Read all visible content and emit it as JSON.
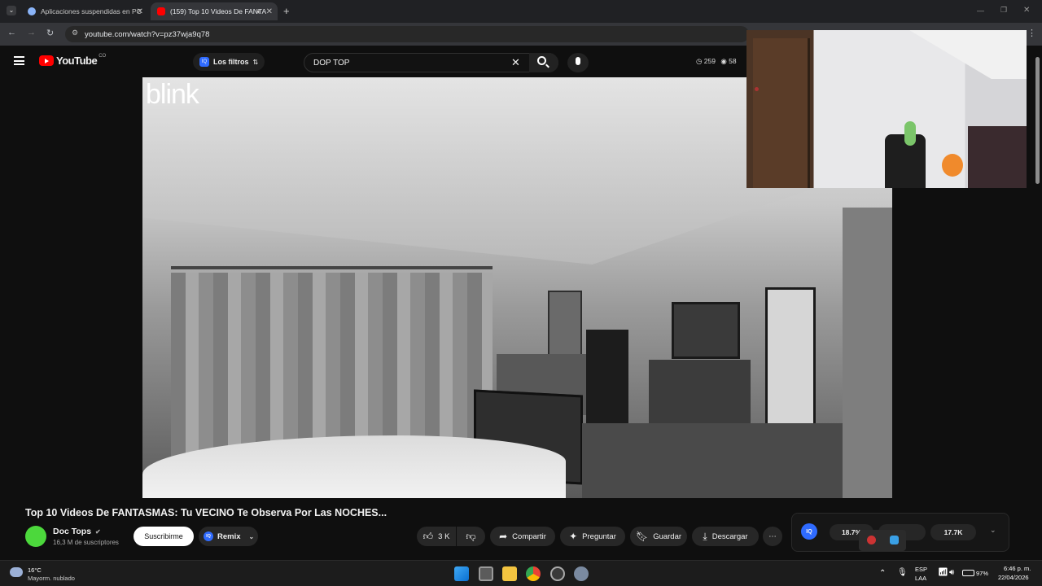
{
  "browser": {
    "tabs": [
      {
        "title": "Aplicaciones suspendidas en PC"
      },
      {
        "title": "(159) Top 10 Videos De FANTA"
      }
    ],
    "url": "youtube.com/watch?v=pz37wja9q78"
  },
  "yt_header": {
    "logo": "YouTube",
    "country": "CO",
    "filters_label": "Los filtros",
    "search_value": "DOP TOP",
    "stat_views": "259",
    "stat_other": "58"
  },
  "video": {
    "watermark": "blink"
  },
  "meta": {
    "title": "Top 10 Videos De FANTASMAS: Tu VECINO Te Observa Por Las NOCHES...",
    "channel": "Doc Tops",
    "subscribers": "16,3 M de suscriptores",
    "subscribe_label": "Suscribirme",
    "remix_label": "Remix",
    "likes": "3 K",
    "share_label": "Compartir",
    "ask_label": "Preguntar",
    "save_label": "Guardar",
    "download_label": "Descargar"
  },
  "iq_panel": {
    "stat1": "18.7%",
    "stat3": "17.7K"
  },
  "taskbar": {
    "weather_temp": "16°C",
    "weather_desc": "Mayorm. nublado",
    "lang_top": "ESP",
    "lang_bottom": "LAA",
    "battery": "97%",
    "time": "6:46 p. m.",
    "date": "22/04/2026"
  },
  "colors": {
    "accent": "#ff0000",
    "background": "#0f0f0f",
    "channel_avatar": "#4cd83c"
  }
}
